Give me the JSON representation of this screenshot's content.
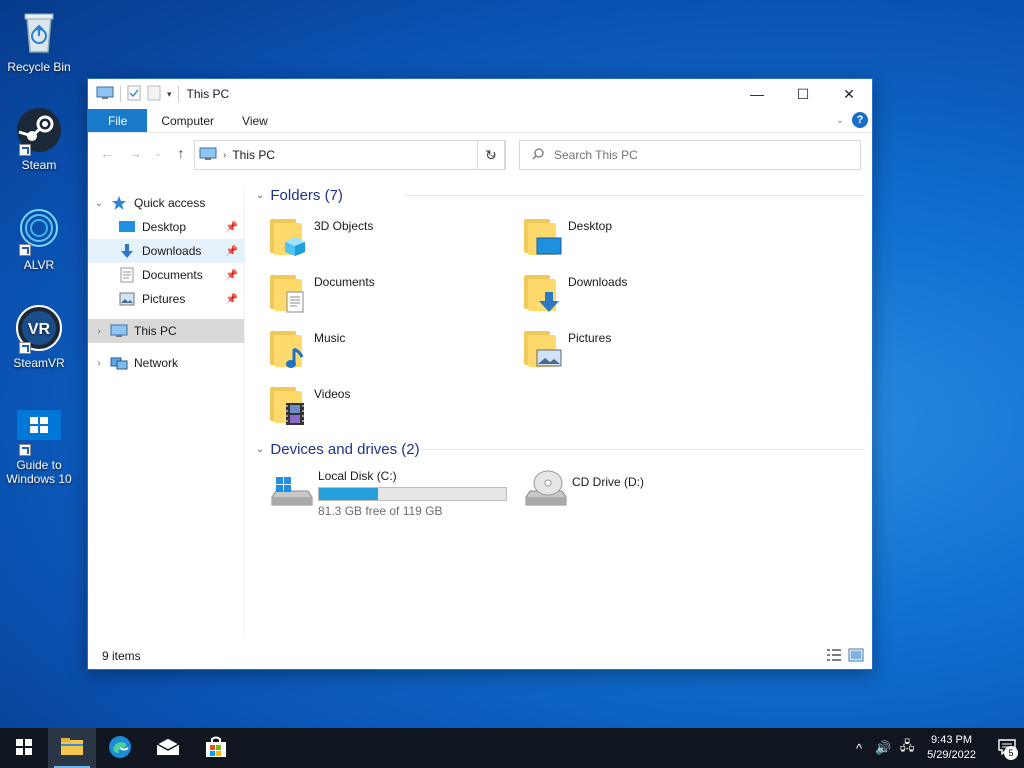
{
  "desktop": {
    "icons": [
      {
        "label": "Recycle Bin",
        "icon": "recycle-bin-icon"
      },
      {
        "label": "Steam",
        "icon": "steam-icon"
      },
      {
        "label": "ALVR",
        "icon": "alvr-icon"
      },
      {
        "label": "SteamVR",
        "icon": "steamvr-icon"
      },
      {
        "label": "Guide to Windows 10",
        "icon": "windows-guide-icon"
      }
    ],
    "steamvr_badge": "VR"
  },
  "window": {
    "title": "This PC",
    "controls": {
      "minimize": "—",
      "maximize": "☐",
      "close": "✕"
    },
    "ribbon_tabs": [
      "File",
      "Computer",
      "View"
    ],
    "help": "?",
    "address": {
      "location": "This PC"
    },
    "search": {
      "placeholder": "Search This PC"
    },
    "sidebar": {
      "quick_access": "Quick access",
      "items": [
        {
          "label": "Desktop",
          "pinned": true
        },
        {
          "label": "Downloads",
          "pinned": true
        },
        {
          "label": "Documents",
          "pinned": true
        },
        {
          "label": "Pictures",
          "pinned": true
        }
      ],
      "this_pc": "This PC",
      "network": "Network"
    },
    "folders_header": "Folders (7)",
    "folders": [
      {
        "name": "3D Objects",
        "icon": "3d-objects-folder-icon"
      },
      {
        "name": "Desktop",
        "icon": "desktop-folder-icon"
      },
      {
        "name": "Documents",
        "icon": "documents-folder-icon"
      },
      {
        "name": "Downloads",
        "icon": "downloads-folder-icon"
      },
      {
        "name": "Music",
        "icon": "music-folder-icon"
      },
      {
        "name": "Pictures",
        "icon": "pictures-folder-icon"
      },
      {
        "name": "Videos",
        "icon": "videos-folder-icon"
      }
    ],
    "drives_header": "Devices and drives (2)",
    "drives": [
      {
        "name": "Local Disk (C:)",
        "free_text": "81.3 GB free of 119 GB",
        "used_fraction": 0.317
      },
      {
        "name": "CD Drive (D:)"
      }
    ],
    "status": "9 items"
  },
  "taskbar": {
    "apps": [
      "start-icon",
      "file-explorer-icon",
      "edge-icon",
      "mail-icon",
      "store-icon"
    ],
    "time": "9:43 PM",
    "date": "5/29/2022",
    "notifications": "5",
    "colors": {
      "accent": "#26a0da",
      "taskbar": "#101620"
    }
  }
}
